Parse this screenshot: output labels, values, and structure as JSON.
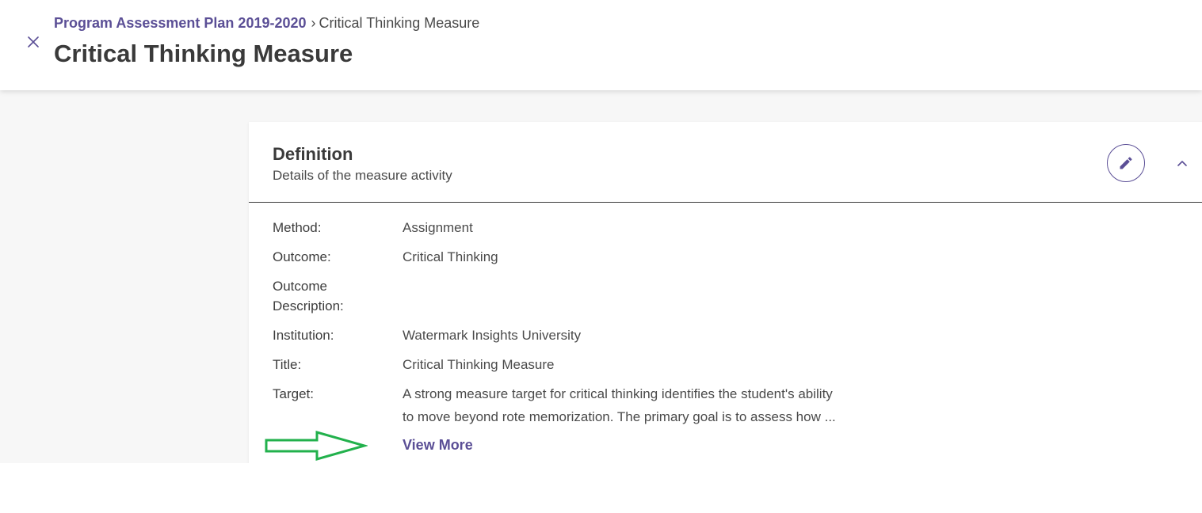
{
  "header": {
    "breadcrumb": {
      "parent": "Program Assessment Plan 2019-2020",
      "separator": "›",
      "current": "Critical Thinking Measure"
    },
    "title": "Critical Thinking Measure"
  },
  "card": {
    "title": "Definition",
    "subtitle": "Details of the measure activity",
    "fields": {
      "method": {
        "label": "Method:",
        "value": "Assignment"
      },
      "outcome": {
        "label": "Outcome:",
        "value": "Critical Thinking"
      },
      "outcome_description": {
        "label_line1": "Outcome",
        "label_line2": "Description:",
        "value": ""
      },
      "institution": {
        "label": "Institution:",
        "value": "Watermark Insights University"
      },
      "title": {
        "label": "Title:",
        "value": "Critical Thinking Measure"
      },
      "target": {
        "label": "Target:",
        "value_line1": "A strong measure target for critical thinking identifies the student's ability",
        "value_line2": "to move beyond rote memorization. The primary goal is to assess how ..."
      }
    },
    "view_more_label": "View More"
  },
  "icons": {
    "close": "close-icon",
    "edit": "pencil-icon",
    "collapse": "chevron-up-icon",
    "annotation": "green-outline-arrow-icon"
  },
  "colors": {
    "accent": "#5b4f96",
    "annotation_arrow": "#22b14c",
    "page_background": "#f7f7f7"
  }
}
